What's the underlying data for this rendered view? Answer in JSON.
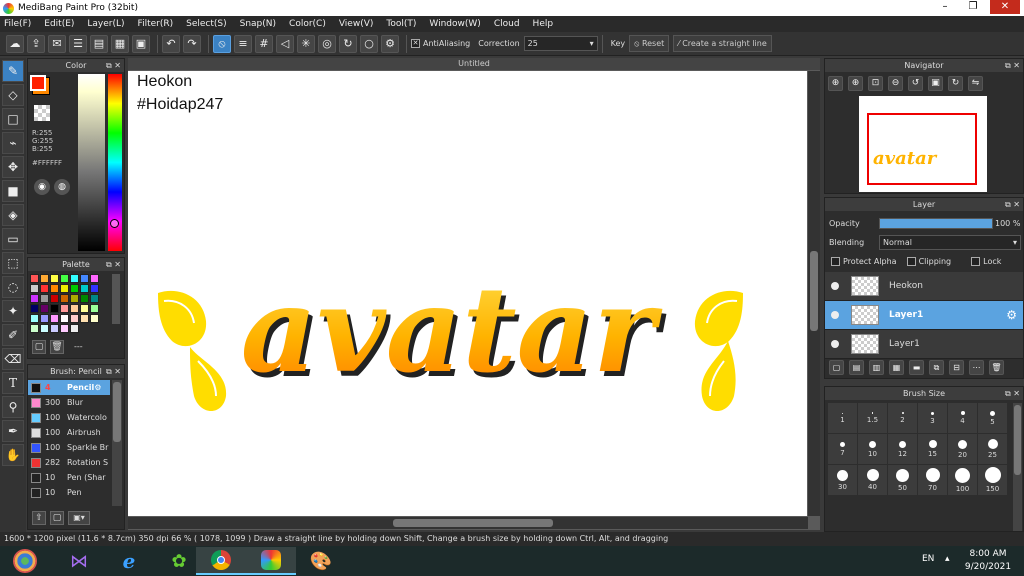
{
  "window": {
    "title": "MediBang Paint Pro (32bit)"
  },
  "menu": [
    "File(F)",
    "Edit(E)",
    "Layer(L)",
    "Filter(R)",
    "Select(S)",
    "Snap(N)",
    "Color(C)",
    "View(V)",
    "Tool(T)",
    "Window(W)",
    "Cloud",
    "Help"
  ],
  "toolbar": {
    "antialiasing_label": "AntiAliasing",
    "correction_label": "Correction",
    "correction_value": "25",
    "key_label": "Key",
    "reset_label": "Reset",
    "straight_line_label": "Create a straight line"
  },
  "color_panel": {
    "title": "Color",
    "rgb": {
      "r": "R:255",
      "g": "G:255",
      "b": "B:255"
    },
    "hex": "#FFFFFF",
    "primary_color": "#ff2200",
    "secondary_color": "#ff8800"
  },
  "palette_panel": {
    "title": "Palette",
    "more_label": "---",
    "colors": [
      "#f55",
      "#fa3",
      "#ff4",
      "#4f4",
      "#3ff",
      "#48f",
      "#f6f",
      "#ccc",
      "#f33",
      "#f80",
      "#ee0",
      "#0c0",
      "#0cc",
      "#33f",
      "#c3f",
      "#999",
      "#c00",
      "#c60",
      "#aa0",
      "#080",
      "#088",
      "#006",
      "#606",
      "#000",
      "#f99",
      "#fc9",
      "#ff9",
      "#9f9",
      "#9ff",
      "#99f",
      "#f9f",
      "#fff",
      "#fcc",
      "#ffe0b0",
      "#ffc",
      "#cfc",
      "#cff",
      "#ccf",
      "#fcf",
      "#eee"
    ]
  },
  "brush_panel": {
    "title": "Brush: Pencil",
    "brushes": [
      {
        "size": "4",
        "name": "Pencil",
        "color": "#111111",
        "selected": true
      },
      {
        "size": "300",
        "name": "Blur",
        "color": "#ff88cc",
        "selected": false
      },
      {
        "size": "100",
        "name": "Watercolo",
        "color": "#66ccff",
        "selected": false
      },
      {
        "size": "100",
        "name": "Airbrush",
        "color": "#dddddd",
        "selected": false
      },
      {
        "size": "100",
        "name": "Sparkle Br",
        "color": "#3355ff",
        "selected": false
      },
      {
        "size": "282",
        "name": "Rotation S",
        "color": "#ee3333",
        "selected": false
      },
      {
        "size": "10",
        "name": "Pen (Shar",
        "color": "#222222",
        "selected": false
      },
      {
        "size": "10",
        "name": "Pen",
        "color": "#222222",
        "selected": false
      }
    ]
  },
  "document": {
    "tab": "Untitled",
    "text_line1": "Heokon",
    "text_line2": "#Hoidap247",
    "artwork_word": "avatar"
  },
  "navigator_panel": {
    "title": "Navigator"
  },
  "layer_panel": {
    "title": "Layer",
    "opacity_label": "Opacity",
    "opacity_percent": 100,
    "opacity_text": "100 %",
    "blending_label": "Blending",
    "blending_value": "Normal",
    "protect_alpha_label": "Protect Alpha",
    "clipping_label": "Clipping",
    "lock_label": "Lock",
    "layers": [
      {
        "name": "Heokon",
        "selected": false
      },
      {
        "name": "Layer1",
        "selected": true
      },
      {
        "name": "Layer1",
        "selected": false
      }
    ]
  },
  "brush_size_panel": {
    "title": "Brush Size",
    "sizes": [
      "1",
      "1.5",
      "2",
      "3",
      "4",
      "5",
      "7",
      "10",
      "12",
      "15",
      "20",
      "25",
      "30",
      "40",
      "50",
      "70",
      "100",
      "150"
    ]
  },
  "status": {
    "text": "1600 * 1200 pixel  (11.6 * 8.7cm)  350 dpi  66 %  ( 1078, 1099 )  Draw a straight line by holding down Shift, Change a brush size by holding down Ctrl, Alt, and dragging"
  },
  "taskbar": {
    "lang": "EN",
    "time": "8:00 AM",
    "date": "9/20/2021"
  }
}
